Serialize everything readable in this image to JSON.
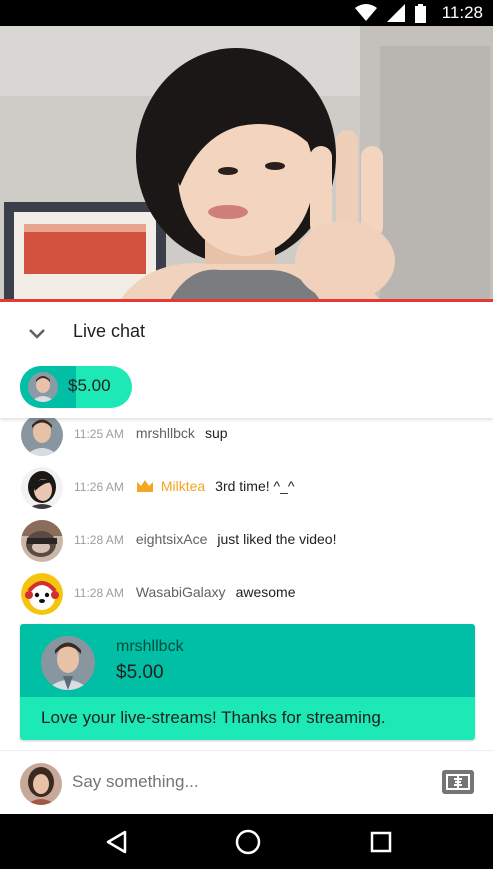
{
  "status_bar": {
    "time": "11:28",
    "icons": [
      "wifi-icon",
      "cell-signal-icon",
      "battery-icon"
    ]
  },
  "video": {
    "description_icon": "video-player"
  },
  "chat_header": {
    "title": "Live chat",
    "collapse_icon": "chevron-down-icon"
  },
  "ticker": {
    "amount": "$5.00",
    "progress_fraction": 0.5
  },
  "messages": [
    {
      "time": "11:25 AM",
      "author": "mrshllbck",
      "text": "sup",
      "badge": ""
    },
    {
      "time": "11:26 AM",
      "author": "Milktea",
      "text": "3rd time! ^_^",
      "badge": "crown-icon"
    },
    {
      "time": "11:28 AM",
      "author": "eightsixAce",
      "text": "just liked the video!",
      "badge": ""
    },
    {
      "time": "11:28 AM",
      "author": "WasabiGalaxy",
      "text": "awesome",
      "badge": ""
    }
  ],
  "super_chat": {
    "author": "mrshllbck",
    "amount": "$5.00",
    "message": "Love your live-streams! Thanks for streaming."
  },
  "input": {
    "placeholder": "Say something...",
    "money_icon": "super-chat-dollar-icon"
  },
  "nav_bar": {
    "buttons": [
      "back-icon",
      "home-icon",
      "recents-icon"
    ]
  },
  "colors": {
    "accent_dark": "#00bfa5",
    "accent_light": "#1de9b6",
    "progress_red": "#e53935",
    "member_gold": "#f4a522"
  }
}
